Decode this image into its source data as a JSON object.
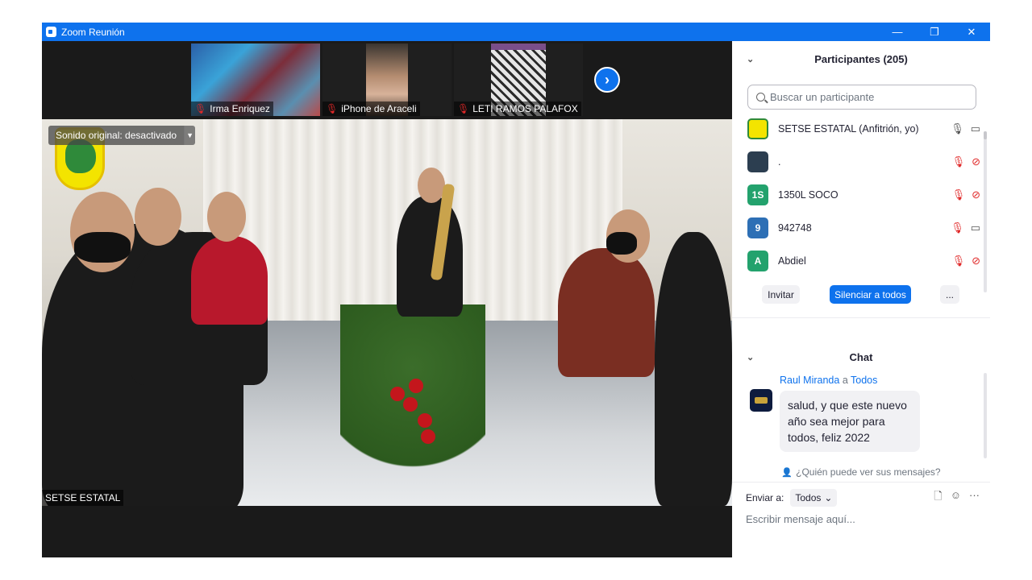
{
  "window": {
    "title": "Zoom Reunión",
    "controls": {
      "minimize": "—",
      "restore": "❐",
      "close": "✕"
    }
  },
  "thumbnails": [
    {
      "name": "Irma Enriquez"
    },
    {
      "name": "iPhone de Araceli"
    },
    {
      "name": "LETI RAMOS PALAFOX"
    }
  ],
  "next_page_icon": "chevron-right-icon",
  "main_video": {
    "audio_label": "Sonido original: desactivado",
    "speaker_name": "SETSE ESTATAL"
  },
  "participants": {
    "header": "Participantes (205)",
    "search_placeholder": "Buscar un participante",
    "list": [
      {
        "name": "SETSE ESTATAL (Anfitrión, yo)",
        "avatar_text": "",
        "avatar_color": "#f3e400",
        "mic": "on",
        "video": "on"
      },
      {
        "name": ".",
        "avatar_text": "",
        "avatar_color": "#2c3e50",
        "mic": "muted",
        "video": "off"
      },
      {
        "name": "1350L SOCO",
        "avatar_text": "1S",
        "avatar_color": "#23a26d",
        "mic": "muted",
        "video": "off"
      },
      {
        "name": "942748",
        "avatar_text": "9",
        "avatar_color": "#2d6fb5",
        "mic": "muted",
        "video": "on"
      },
      {
        "name": "Abdiel",
        "avatar_text": "A",
        "avatar_color": "#23a26d",
        "mic": "muted",
        "video": "off"
      }
    ],
    "invite_label": "Invitar",
    "mute_all_label": "Silenciar a todos",
    "more_label": "..."
  },
  "chat": {
    "header": "Chat",
    "message": {
      "sender": "Raul Miranda",
      "to_word": "a",
      "recipient": "Todos",
      "text": "salud, y que este nuevo año sea mejor para todos, feliz 2022"
    },
    "who_can_see": "¿Quién puede ver sus mensajes?",
    "send_to_label": "Enviar a:",
    "send_to_value": "Todos",
    "compose_placeholder": "Escribir mensaje aquí..."
  },
  "colors": {
    "accent": "#0e72ed",
    "muted_red": "#e02828"
  }
}
